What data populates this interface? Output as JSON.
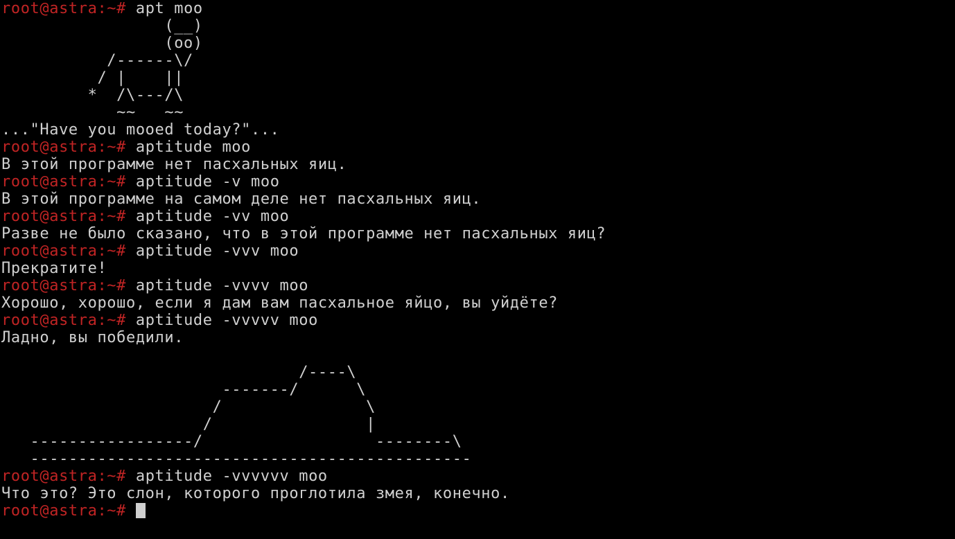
{
  "terminal": {
    "prompt": "root@astra:~#",
    "cursor_color": "#cfcfcf",
    "prompt_color": "#c02424",
    "text_color": "#d0d0d0",
    "lines": [
      {
        "type": "prompt",
        "command": "apt moo"
      },
      {
        "type": "output",
        "text": "                 (__)"
      },
      {
        "type": "output",
        "text": "                 (oo)"
      },
      {
        "type": "output",
        "text": "           /------\\/"
      },
      {
        "type": "output",
        "text": "          / |    ||"
      },
      {
        "type": "output",
        "text": "         *  /\\---/\\"
      },
      {
        "type": "output",
        "text": "            ~~   ~~"
      },
      {
        "type": "output",
        "text": "...\"Have you mooed today?\"..."
      },
      {
        "type": "prompt",
        "command": "aptitude moo"
      },
      {
        "type": "output",
        "text": "В этой программе нет пасхальных яиц."
      },
      {
        "type": "prompt",
        "command": "aptitude -v moo"
      },
      {
        "type": "output",
        "text": "В этой программе на самом деле нет пасхальных яиц."
      },
      {
        "type": "prompt",
        "command": "aptitude -vv moo"
      },
      {
        "type": "output",
        "text": "Разве не было сказано, что в этой программе нет пасхальных яиц?"
      },
      {
        "type": "prompt",
        "command": "aptitude -vvv moo"
      },
      {
        "type": "output",
        "text": "Прекратите!"
      },
      {
        "type": "prompt",
        "command": "aptitude -vvvv moo"
      },
      {
        "type": "output",
        "text": "Хорошо, хорошо, если я дам вам пасхальное яйцо, вы уйдёте?"
      },
      {
        "type": "prompt",
        "command": "aptitude -vvvvv moo"
      },
      {
        "type": "output",
        "text": "Ладно, вы победили."
      },
      {
        "type": "output",
        "text": ""
      },
      {
        "type": "output",
        "text": "                               /----\\"
      },
      {
        "type": "output",
        "text": "                       -------/      \\"
      },
      {
        "type": "output",
        "text": "                      /               \\"
      },
      {
        "type": "output",
        "text": "                     /                |"
      },
      {
        "type": "output",
        "text": "   -----------------/                  --------\\"
      },
      {
        "type": "output",
        "text": "   ----------------------------------------------"
      },
      {
        "type": "prompt",
        "command": "aptitude -vvvvvv moo"
      },
      {
        "type": "output",
        "text": "Что это? Это слон, которого проглотила змея, конечно."
      },
      {
        "type": "prompt",
        "command": "",
        "cursor": true
      }
    ]
  }
}
